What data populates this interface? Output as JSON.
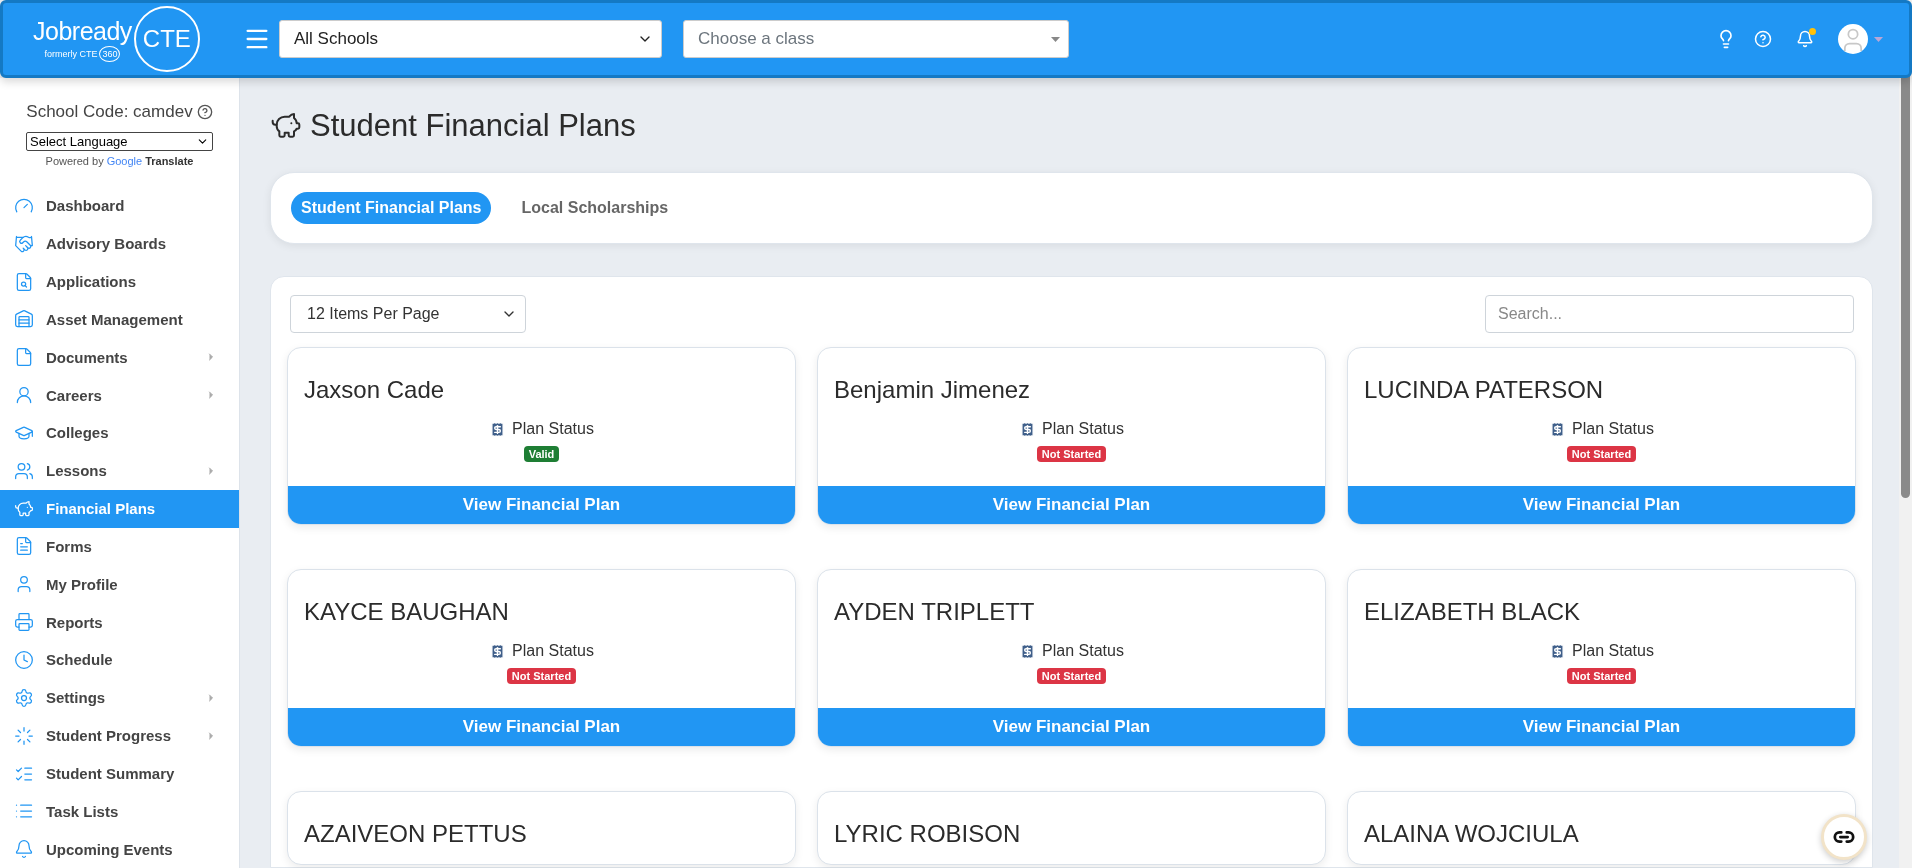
{
  "header": {
    "logo": {
      "name": "Jobready",
      "badge": "CTE",
      "tagline": "formerly CTE",
      "tagline_badge": "360"
    },
    "school_select": "All Schools",
    "class_select": {
      "placeholder": "Choose a class"
    },
    "notifications": {
      "unread": true
    }
  },
  "sidebar": {
    "school_code": "School Code: camdev",
    "language_select": "Select Language",
    "powered_by": "Powered by",
    "google": "Google",
    "translate": "Translate",
    "items": [
      {
        "label": "Dashboard",
        "selected": false,
        "has_submenu": false
      },
      {
        "label": "Advisory Boards",
        "selected": false,
        "has_submenu": false
      },
      {
        "label": "Applications",
        "selected": false,
        "has_submenu": false
      },
      {
        "label": "Asset Management",
        "selected": false,
        "has_submenu": false
      },
      {
        "label": "Documents",
        "selected": false,
        "has_submenu": true
      },
      {
        "label": "Careers",
        "selected": false,
        "has_submenu": true
      },
      {
        "label": "Colleges",
        "selected": false,
        "has_submenu": false
      },
      {
        "label": "Lessons",
        "selected": false,
        "has_submenu": true
      },
      {
        "label": "Financial Plans",
        "selected": true,
        "has_submenu": false
      },
      {
        "label": "Forms",
        "selected": false,
        "has_submenu": false
      },
      {
        "label": "My Profile",
        "selected": false,
        "has_submenu": false
      },
      {
        "label": "Reports",
        "selected": false,
        "has_submenu": false
      },
      {
        "label": "Schedule",
        "selected": false,
        "has_submenu": false
      },
      {
        "label": "Settings",
        "selected": false,
        "has_submenu": true
      },
      {
        "label": "Student Progress",
        "selected": false,
        "has_submenu": true
      },
      {
        "label": "Student Summary",
        "selected": false,
        "has_submenu": false
      },
      {
        "label": "Task Lists",
        "selected": false,
        "has_submenu": false
      },
      {
        "label": "Upcoming Events",
        "selected": false,
        "has_submenu": false
      }
    ]
  },
  "page": {
    "title": "Student Financial Plans",
    "tabs": [
      {
        "label": "Student Financial Plans",
        "selected": true
      },
      {
        "label": "Local Scholarships",
        "selected": false
      }
    ],
    "per_page": "12 Items Per Page",
    "search": {
      "placeholder": "Search..."
    },
    "students": [
      {
        "name": "Jaxson Cade",
        "status_label": "Plan Status",
        "status": {
          "label": "Valid",
          "color": "#1e7e34"
        },
        "button": "View Financial Plan"
      },
      {
        "name": "Benjamin Jimenez",
        "status_label": "Plan Status",
        "status": {
          "label": "Not Started",
          "color": "#dc3545"
        },
        "button": "View Financial Plan"
      },
      {
        "name": "LUCINDA PATERSON",
        "status_label": "Plan Status",
        "status": {
          "label": "Not Started",
          "color": "#dc3545"
        },
        "button": "View Financial Plan"
      },
      {
        "name": "KAYCE BAUGHAN",
        "status_label": "Plan Status",
        "status": {
          "label": "Not Started",
          "color": "#dc3545"
        },
        "button": "View Financial Plan"
      },
      {
        "name": "AYDEN TRIPLETT",
        "status_label": "Plan Status",
        "status": {
          "label": "Not Started",
          "color": "#dc3545"
        },
        "button": "View Financial Plan"
      },
      {
        "name": "ELIZABETH BLACK",
        "status_label": "Plan Status",
        "status": {
          "label": "Not Started",
          "color": "#dc3545"
        },
        "button": "View Financial Plan"
      },
      {
        "name": "AZAIVEON PETTUS"
      },
      {
        "name": "LYRIC ROBISON"
      },
      {
        "name": "ALAINA WOJCIULA"
      }
    ]
  }
}
